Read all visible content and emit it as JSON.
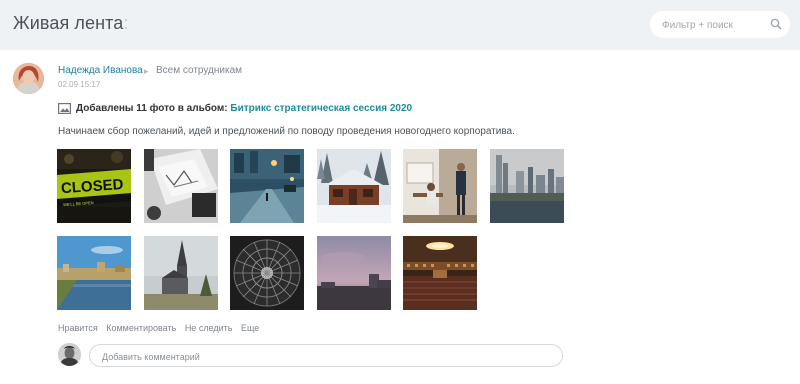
{
  "header": {
    "title": "Живая лента",
    "separator": ":",
    "filter_placeholder": "Фильтр + поиск",
    "search_icon": "search-icon"
  },
  "post": {
    "author": "Надежда Иванова",
    "recipients": "Всем сотрудникам",
    "datetime": "02.09 15:17",
    "album_prefix": "Добавлены 11 фото в альбом:",
    "album_name": "Битрикс стратегическая сессия 2020",
    "text": "Начинаем сбор пожеланий, идей и предложений по поводу проведения новогоднего корпоратива.",
    "photos": [
      {
        "name": "closed-sign-photo",
        "sign_text": "CLOSED",
        "sign_subtext": "WE'LL BE OPEN"
      },
      {
        "name": "papers-desk-photo"
      },
      {
        "name": "street-night-photo"
      },
      {
        "name": "snow-cabin-photo"
      },
      {
        "name": "office-people-photo"
      },
      {
        "name": "city-skyline-photo"
      },
      {
        "name": "river-town-photo"
      },
      {
        "name": "church-photo"
      },
      {
        "name": "dome-ceiling-photo"
      },
      {
        "name": "dusk-buildings-photo"
      },
      {
        "name": "concert-hall-photo"
      }
    ],
    "actions": {
      "like": "Нравится",
      "comment": "Комментировать",
      "unfollow": "Не следить",
      "more": "Еще"
    },
    "comment_placeholder": "Добавить комментарий"
  },
  "colors": {
    "header_bg": "#eef2f4",
    "link": "#1b8c9c",
    "author": "#1f6fb5"
  }
}
